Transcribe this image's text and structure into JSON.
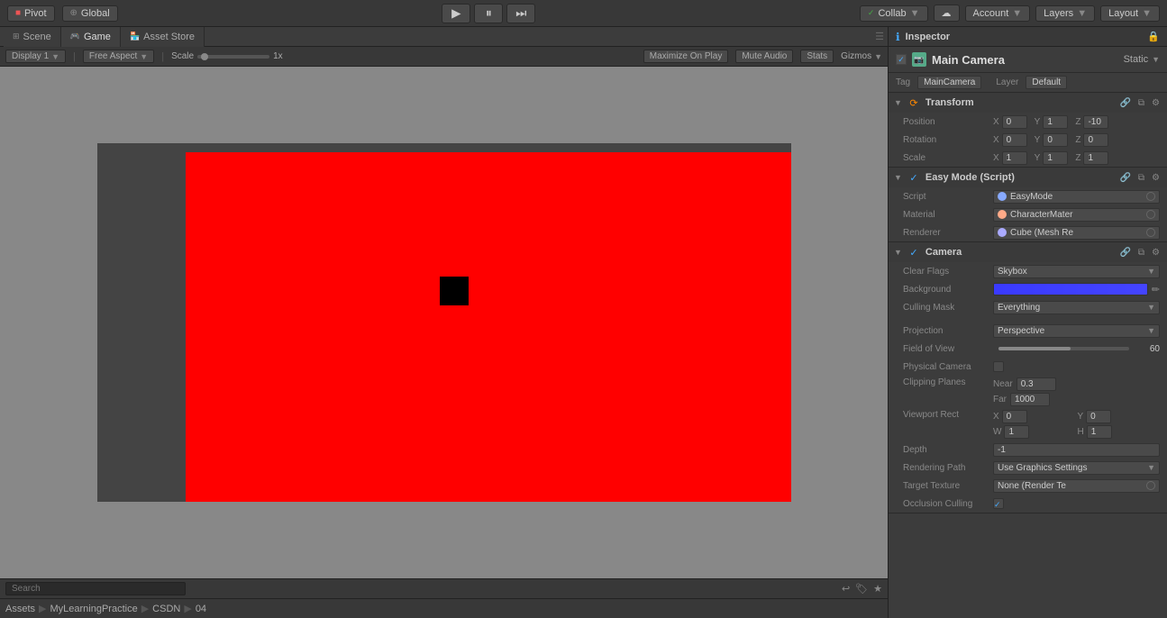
{
  "toolbar": {
    "pivot_label": "Pivot",
    "global_label": "Global",
    "collab_label": "Collab",
    "account_label": "Account",
    "layers_label": "Layers",
    "layout_label": "Layout",
    "cloud_icon": "☁",
    "play_icon": "▶",
    "pause_icon": "⏸",
    "step_icon": "⏭"
  },
  "tabs": {
    "scene_label": "Scene",
    "game_label": "Game",
    "asset_store_label": "Asset Store"
  },
  "game_toolbar": {
    "display_label": "Display 1",
    "aspect_label": "Free Aspect",
    "scale_label": "Scale",
    "scale_value": "1x",
    "maximize_label": "Maximize On Play",
    "mute_label": "Mute Audio",
    "stats_label": "Stats",
    "gizmos_label": "Gizmos"
  },
  "inspector": {
    "title": "Inspector",
    "object_name": "Main Camera",
    "static_label": "Static",
    "tag_label": "Tag",
    "tag_value": "MainCamera",
    "layer_label": "Layer",
    "layer_value": "Default"
  },
  "transform": {
    "title": "Transform",
    "position_label": "Position",
    "pos_x": "0",
    "pos_y": "1",
    "pos_z": "-10",
    "rotation_label": "Rotation",
    "rot_x": "0",
    "rot_y": "0",
    "rot_z": "0",
    "scale_label": "Scale",
    "scale_x": "1",
    "scale_y": "1",
    "scale_z": "1"
  },
  "easy_mode": {
    "title": "Easy Mode (Script)",
    "script_label": "Script",
    "script_value": "EasyMode",
    "material_label": "Material",
    "material_value": "CharacterMater",
    "renderer_label": "Renderer",
    "renderer_value": "Cube (Mesh Re"
  },
  "camera": {
    "title": "Camera",
    "clear_flags_label": "Clear Flags",
    "clear_flags_value": "Skybox",
    "background_label": "Background",
    "culling_mask_label": "Culling Mask",
    "culling_mask_value": "Everything",
    "projection_label": "Projection",
    "projection_value": "Perspective",
    "fov_label": "Field of View",
    "fov_value": "60",
    "physical_camera_label": "Physical Camera",
    "clipping_label": "Clipping Planes",
    "near_label": "Near",
    "near_value": "0.3",
    "far_label": "Far",
    "far_value": "1000",
    "viewport_label": "Viewport Rect",
    "vp_x": "0",
    "vp_y": "0",
    "vp_w": "1",
    "vp_h": "1",
    "depth_label": "Depth",
    "depth_value": "-1",
    "render_path_label": "Rendering Path",
    "render_path_value": "Use Graphics Settings",
    "target_texture_label": "Target Texture",
    "target_texture_value": "None (Render Te"
  },
  "breadcrumb": {
    "assets": "Assets",
    "sep1": "▶",
    "my_learning": "MyLearningPractice",
    "sep2": "▶",
    "csdn": "CSDN",
    "sep3": "▶",
    "folder": "04"
  }
}
